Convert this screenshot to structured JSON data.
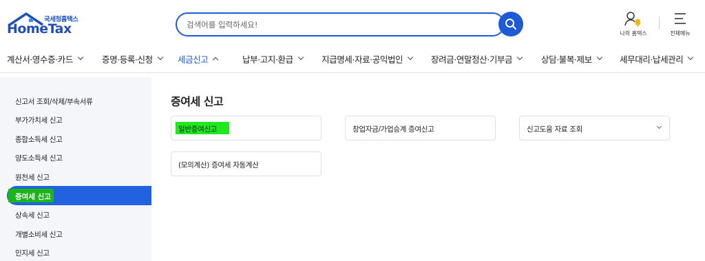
{
  "header": {
    "logo_sub": "국세청홈택스",
    "logo_main": "HomeTax",
    "search_placeholder": "검색어를 입력하세요!",
    "my_hometax_label": "나의 홈택스",
    "all_menu_label": "전체메뉴"
  },
  "gnb": {
    "items": [
      {
        "label": "계산서·영수증·카드"
      },
      {
        "label": "증명·등록·신청"
      },
      {
        "label": "세금신고"
      },
      {
        "label": "납부·고지·환급"
      },
      {
        "label": "지급명세·자료·공익법인"
      },
      {
        "label": "장려금·연말정산·기부금"
      },
      {
        "label": "상담·불복·제보"
      },
      {
        "label": "세무대리·납세관리"
      }
    ],
    "active_index": 2
  },
  "sidebar": {
    "items": [
      {
        "label": "신고서 조회/삭제/부속서류"
      },
      {
        "label": "부가가치세 신고"
      },
      {
        "label": "종합소득세 신고"
      },
      {
        "label": "양도소득세 신고"
      },
      {
        "label": "원천세 신고"
      },
      {
        "label": "증여세 신고"
      },
      {
        "label": "상속세 신고"
      },
      {
        "label": "개별소비세 신고"
      },
      {
        "label": "인지세 신고"
      }
    ],
    "active_index": 5
  },
  "main": {
    "title": "증여세 신고",
    "cards": [
      {
        "label": "일반증여신고"
      },
      {
        "label": "창업자금/가업승계 증여신고"
      },
      {
        "label": "신고도움 자료 조회"
      },
      {
        "label": "(모의계산) 증여세 자동계산"
      }
    ]
  },
  "colors": {
    "brand_blue": "#1e5ad6",
    "highlight_green": "#1ee81e",
    "sidebar_bg": "#f4f6f9"
  }
}
